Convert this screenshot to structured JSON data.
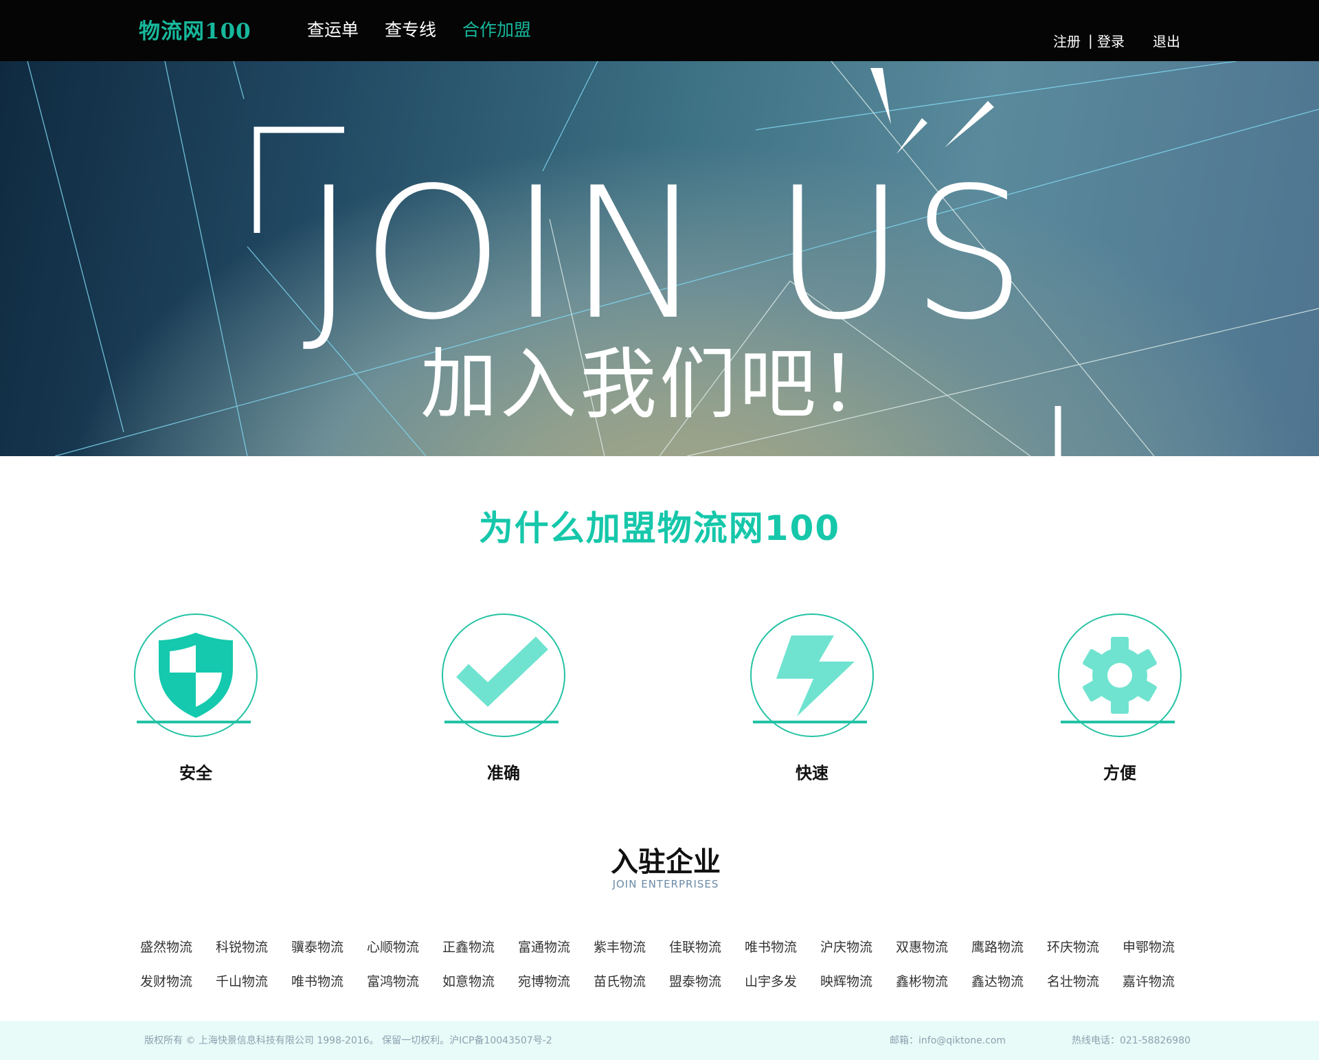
{
  "header": {
    "logo": "物流网100",
    "nav": [
      {
        "label": "查运单",
        "active": false
      },
      {
        "label": "查专线",
        "active": false
      },
      {
        "label": "合作加盟",
        "active": true
      }
    ],
    "register": "注册",
    "separator": "|",
    "login": "登录",
    "logout": "退出"
  },
  "hero": {
    "title_en": "JOIN US",
    "title_cn": "加入我们吧！"
  },
  "why": {
    "title": "为什么加盟物流网100",
    "features": [
      {
        "label": "安全",
        "icon": "shield-icon"
      },
      {
        "label": "准确",
        "icon": "checkmark-icon"
      },
      {
        "label": "快速",
        "icon": "lightning-icon"
      },
      {
        "label": "方便",
        "icon": "gear-icon"
      }
    ]
  },
  "enterprises": {
    "title": "入驻企业",
    "subtitle": "JOIN ENTERPRISES",
    "items": [
      "盛然物流",
      "科锐物流",
      "骥泰物流",
      "心顺物流",
      "正鑫物流",
      "富通物流",
      "紫丰物流",
      "佳联物流",
      "唯书物流",
      "沪庆物流",
      "双惠物流",
      "鹰路物流",
      "环庆物流",
      "申鄂物流",
      "发财物流",
      "千山物流",
      "唯书物流",
      "富鸿物流",
      "如意物流",
      "宛博物流",
      "苗氏物流",
      "盟泰物流",
      "山宇多发",
      "映辉物流",
      "鑫彬物流",
      "鑫达物流",
      "名壮物流",
      "嘉许物流"
    ]
  },
  "footer": {
    "copyright": "版权所有 © 上海快景信息科技有限公司 1998-2016。 保留一切权利。沪ICP备10043507号-2",
    "email": "邮箱：info@qiktone.com",
    "hotline": "热线电话：021-58826980"
  },
  "colors": {
    "accent": "#16c7aa",
    "icon_light": "#6fe3d0",
    "topbar": "#050505",
    "footer_bg": "#e9fbf8"
  }
}
